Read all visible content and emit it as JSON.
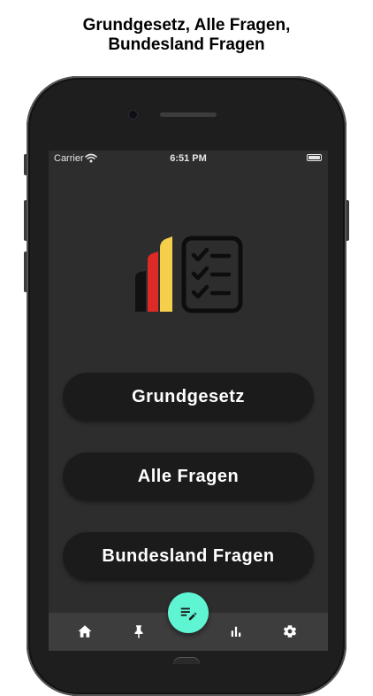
{
  "headline": {
    "line1": "Grundgesetz, Alle Fragen,",
    "line2": "Bundesland Fragen"
  },
  "status_bar": {
    "carrier": "Carrier",
    "time": "6:51 PM",
    "icons": [
      "wifi-icon",
      "battery-icon"
    ]
  },
  "logo": {
    "bars_colors": [
      "#111111",
      "#dd2a26",
      "#f5cf4b"
    ],
    "icon": "checklist-icon"
  },
  "menu": {
    "grundgesetz": "Grundgesetz",
    "alle_fragen": "Alle Fragen",
    "bundesland_fragen": "Bundesland Fragen"
  },
  "tab_bar": {
    "items": [
      "home-icon",
      "pin-icon",
      "stats-icon",
      "settings-icon"
    ],
    "fab_icon": "edit-note-icon",
    "fab_color": "#5ff5d3"
  },
  "colors": {
    "screen_bg": "#2d2d2d",
    "button_bg": "#1b1b1b",
    "tab_bar_bg": "#3d3d3d"
  }
}
